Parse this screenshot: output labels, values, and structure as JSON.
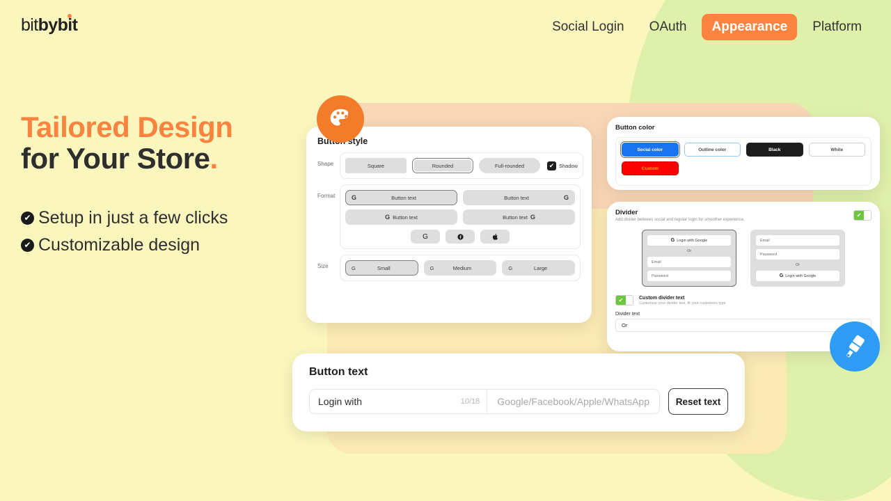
{
  "brand": {
    "part1": "bit",
    "part2": "by",
    "part3": "bit"
  },
  "nav": {
    "items": [
      {
        "label": "Social Login",
        "active": false
      },
      {
        "label": "OAuth",
        "active": false
      },
      {
        "label": "Appearance",
        "active": true
      },
      {
        "label": "Platform",
        "active": false
      }
    ]
  },
  "hero": {
    "line1": "Tailored Design",
    "line2": "for Your Store",
    "period": ".",
    "bullets": [
      {
        "check": "✔",
        "label": "Setup in just a few clicks"
      },
      {
        "check": "✔",
        "label": "Customizable design"
      }
    ]
  },
  "button_style": {
    "title": "Button style",
    "shape": {
      "label": "Shape",
      "options": [
        {
          "label": "Square",
          "selected": false
        },
        {
          "label": "Rounded",
          "selected": true
        },
        {
          "label": "Full-rounded",
          "selected": false
        }
      ],
      "shadow": {
        "label": "Shadow",
        "checked": true,
        "check": "✔"
      }
    },
    "format": {
      "label": "Format",
      "options": [
        {
          "label": "Button text",
          "icon": "G",
          "icon_side": "left",
          "selected": true
        },
        {
          "label": "Button text",
          "icon": "G",
          "icon_side": "right",
          "selected": false
        },
        {
          "label": "Button text",
          "icon": "G",
          "icon_side": "left-center",
          "selected": false
        },
        {
          "label": "Button text",
          "icon": "G",
          "icon_side": "right-center",
          "selected": false
        }
      ],
      "icon_only": [
        {
          "icon": "G",
          "name": "google-icon"
        },
        {
          "icon": "f",
          "name": "facebook-icon"
        },
        {
          "icon": "",
          "name": "apple-icon"
        }
      ]
    },
    "size": {
      "label": "Size",
      "options": [
        {
          "label": "Small",
          "icon": "G",
          "selected": true
        },
        {
          "label": "Medium",
          "icon": "G",
          "selected": false
        },
        {
          "label": "Large",
          "icon": "G",
          "selected": false
        }
      ]
    }
  },
  "button_color": {
    "title": "Button color",
    "options": [
      {
        "label": "Social color",
        "selected": true,
        "color": "#1a73f0"
      },
      {
        "label": "Outline color",
        "selected": false,
        "color": "#ffffff"
      },
      {
        "label": "Black",
        "selected": false,
        "color": "#1d1d1d"
      },
      {
        "label": "White",
        "selected": false,
        "color": "#ffffff"
      },
      {
        "label": "Custom",
        "selected": false,
        "color": "#fe0000"
      }
    ]
  },
  "divider": {
    "title": "Divider",
    "subtitle": "Add divider between social and regular login for smoother experience.",
    "enabled": true,
    "toggle_check": "✔",
    "previews": [
      {
        "selected": true,
        "rows": [
          {
            "type": "google",
            "label": "Login with Google",
            "icon": "G"
          },
          {
            "type": "or",
            "label": "Or"
          },
          {
            "type": "field",
            "label": "Email"
          },
          {
            "type": "field",
            "label": "Password"
          }
        ]
      },
      {
        "selected": false,
        "rows": [
          {
            "type": "field",
            "label": "Email"
          },
          {
            "type": "field",
            "label": "Password"
          },
          {
            "type": "or",
            "label": "Or"
          },
          {
            "type": "google",
            "label": "Login with Google",
            "icon": "G"
          }
        ]
      }
    ],
    "custom_divider_text": {
      "enabled": true,
      "toggle_check": "✔",
      "title": "Custom divider text",
      "subtitle": "Customize your divider text, fit your customers type"
    },
    "divider_text": {
      "label": "Divider text",
      "value": "Or"
    }
  },
  "button_text": {
    "title": "Button text",
    "value": "Login with",
    "counter": "10/18",
    "suffix": "Google/Facebook/Apple/WhatsApp",
    "reset_label": "Reset text"
  },
  "badges": {
    "palette": "palette-icon",
    "brush": "paintbrush-icon"
  },
  "colors": {
    "accent": "#f9833f",
    "page_bg": "#fbf6bd",
    "green_blob": "#dff0ab",
    "peach_panel": "#f8d7b6",
    "cream_panel": "#fbeab4",
    "social_blue": "#1a73f0",
    "toggle_green": "#6ec83f",
    "custom_red": "#fe0000"
  }
}
